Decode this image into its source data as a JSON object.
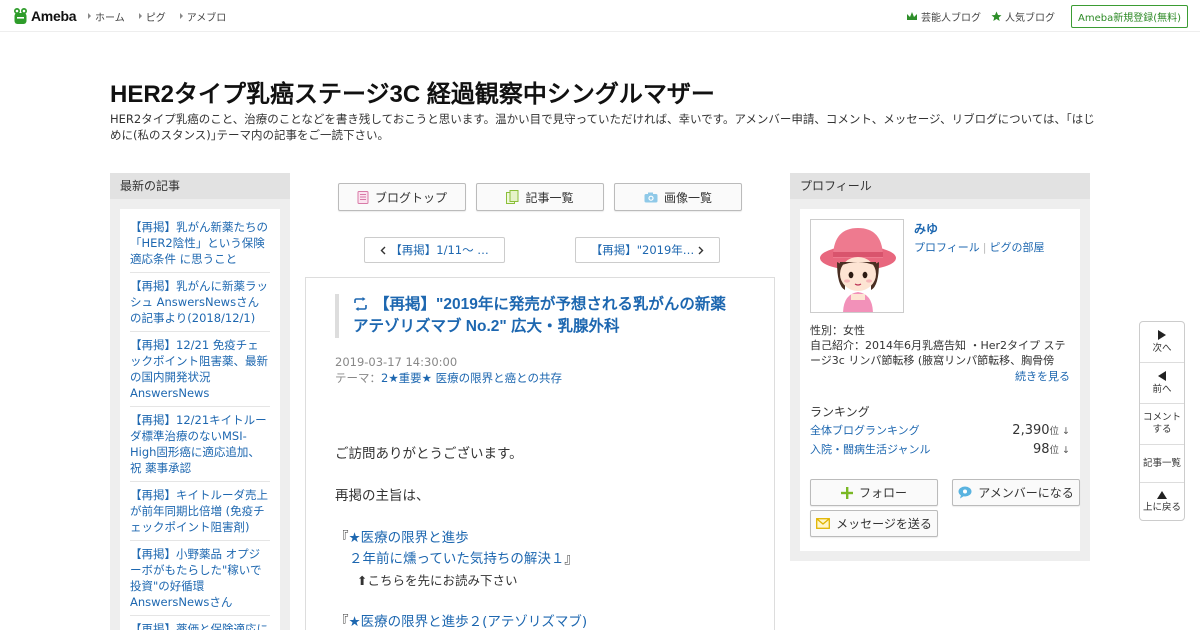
{
  "header": {
    "logo_text": "Ameba",
    "nav": [
      "ホーム",
      "ピグ",
      "アメブロ"
    ],
    "celebrity_blog": "芸能人ブログ",
    "popular_blog": "人気ブログ",
    "register": "Ameba新規登録(無料)"
  },
  "blog": {
    "title": "HER2タイプ乳癌ステージ3C 経過観察中シングルマザー",
    "description": "HER2タイプ乳癌のこと、治療のことなどを書き残しておこうと思います。温かい目で見守っていただければ、幸いです。アメンバー申請、コメント、メッセージ、リブログについては、｢はじめに(私のスタンス)｣テーマ内の記事をご一読下さい。"
  },
  "recent": {
    "heading": "最新の記事",
    "items": [
      "【再掲】乳がん新薬たちの「HER2陰性」という保険適応条件 に思うこと",
      "【再掲】乳がんに新薬ラッシュ AnswersNewsさんの記事より(2018/12/1)",
      "【再掲】12/21 免疫チェックポイント阻害薬、最新の国内開発状況 AnswersNews",
      "【再掲】12/21キイトルーダ標準治療のないMSI-High固形癌に適応追加、祝 薬事承認",
      "【再掲】キイトルーダ売上が前年同期比倍増 (免疫チェックポイント阻害剤)",
      "【再掲】小野薬品 オプジーボがもたらした\"稼いで投資\"の好循環 AnswersNewsさん",
      "【再掲】薬価と保険適応について"
    ]
  },
  "toolbar": {
    "blog_top": "ブログトップ",
    "article_list": "記事一覧",
    "image_list": "画像一覧"
  },
  "pager": {
    "prev": "【再掲】1/11～ …",
    "next": "【再掲】\"2019年…"
  },
  "article": {
    "title": "【再掲】\"2019年に発売が予想される乳がんの新薬 アテゾリズマブ No.2\" 広大・乳腺外科",
    "date": "2019-03-17 14:30:00",
    "theme_label": "テーマ：",
    "theme": "2★重要★ 医療の限界と癌との共存",
    "greeting": "ご訪問ありがとうございます。",
    "purpose": "再掲の主旨は、",
    "quote_open": "『",
    "link1_line1": "★医療の限界と進歩",
    "link1_line2": "２年前に燻っていた気持ちの解決１",
    "quote_close": "』",
    "read_first": "⬆こちらを先にお読み下さい",
    "link2": "★医療の限界と進歩２(アテゾリズマブ)"
  },
  "profile": {
    "heading": "プロフィール",
    "name": "みゆ",
    "link_profile": "プロフィール",
    "link_pigg": "ピグの部屋",
    "gender": "性別：女性",
    "intro": "自己紹介：2014年6月乳癌告知 ・Her2タイプ ステージ3c リンパ節転移 (腋窩リンパ節転移、胸骨傍リ...",
    "more": "続きを見る",
    "ranking_heading": "ランキング",
    "ranking": [
      {
        "label": "全体ブログランキング",
        "value": "2,390",
        "unit": "位 ↓"
      },
      {
        "label": "入院・闘病生活ジャンル",
        "value": "98",
        "unit": "位 ↓"
      }
    ],
    "follow": "フォロー",
    "amember": "アメンバーになる",
    "message": "メッセージを送る"
  },
  "sidenav": {
    "next": "次へ",
    "prev": "前へ",
    "comment_1": "コメント",
    "comment_2": "する",
    "list": "記事一覧",
    "top": "上に戻る"
  },
  "colors": {
    "link": "#1d67b0",
    "brand_green": "#2d8a26",
    "panel_gray": "#eeeeee"
  }
}
